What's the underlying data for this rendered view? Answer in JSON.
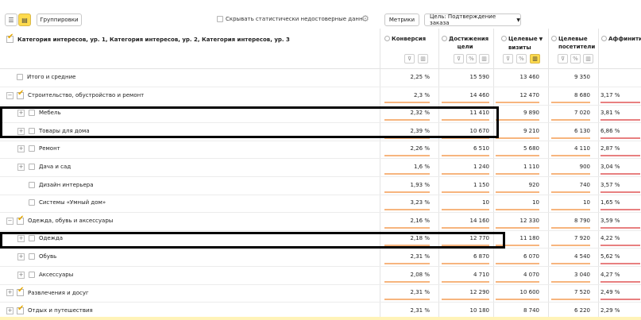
{
  "toolbar": {
    "groupings_label": "Группировки",
    "hide_stats_label": "Скрывать статистически недостоверные данн...",
    "metrics_label": "Метрики",
    "goal_label": "Цель: Подтверждение заказа",
    "icons": [
      "list-view-icon",
      "tree-view-icon",
      "gear-icon",
      "chevron-down-icon"
    ]
  },
  "header": {
    "dimension_title": "Категория интересов, ур. 1, Категория интересов, ур. 2, Категория интересов, ур. 3",
    "columns": [
      {
        "line1": "Конверсия",
        "line2": ""
      },
      {
        "line1": "Достижения",
        "line2": "цели"
      },
      {
        "line1": "Целевые",
        "line2": "визиты",
        "sort": "▼"
      },
      {
        "line1": "Целевые",
        "line2": "посетители"
      },
      {
        "line1": "Аффинити-",
        "line2": ""
      }
    ],
    "mini_icons": [
      "filter-icon",
      "chart-icon",
      "percent-icon"
    ]
  },
  "rows": [
    {
      "level": 0,
      "label": "Итого и средние",
      "checked": false,
      "expander": "",
      "conv": "2,25 %",
      "goals": "15 590",
      "visits": "13 460",
      "visitors": "9 350",
      "aff": ""
    },
    {
      "level": 0,
      "label": "Строительство, обустройство и ремонт",
      "checked": true,
      "expander": "−",
      "conv": "2,3 %",
      "goals": "14 460",
      "visits": "12 470",
      "visitors": "8 680",
      "aff": "3,17 %"
    },
    {
      "level": 1,
      "label": "Мебель",
      "checked": false,
      "expander": "+",
      "conv": "2,32 %",
      "goals": "11 410",
      "visits": "9 890",
      "visitors": "7 020",
      "aff": "3,81 %"
    },
    {
      "level": 1,
      "label": "Товары для дома",
      "checked": false,
      "expander": "+",
      "conv": "2,39 %",
      "goals": "10 670",
      "visits": "9 210",
      "visitors": "6 130",
      "aff": "6,86 %"
    },
    {
      "level": 1,
      "label": "Ремонт",
      "checked": false,
      "expander": "+",
      "conv": "2,26 %",
      "goals": "6 510",
      "visits": "5 680",
      "visitors": "4 110",
      "aff": "2,87 %"
    },
    {
      "level": 1,
      "label": "Дача и сад",
      "checked": false,
      "expander": "+",
      "conv": "1,6 %",
      "goals": "1 240",
      "visits": "1 110",
      "visitors": "900",
      "aff": "3,04 %"
    },
    {
      "level": 1,
      "label": "Дизайн интерьера",
      "checked": false,
      "expander": "",
      "conv": "1,93 %",
      "goals": "1 150",
      "visits": "920",
      "visitors": "740",
      "aff": "3,57 %"
    },
    {
      "level": 1,
      "label": "Системы «Умный дом»",
      "checked": false,
      "expander": "",
      "conv": "3,23 %",
      "goals": "10",
      "visits": "10",
      "visitors": "10",
      "aff": "1,65 %"
    },
    {
      "level": 0,
      "label": "Одежда, обувь и аксессуары",
      "checked": true,
      "expander": "−",
      "conv": "2,16 %",
      "goals": "14 160",
      "visits": "12 330",
      "visitors": "8 790",
      "aff": "3,59 %"
    },
    {
      "level": 1,
      "label": "Одежда",
      "checked": false,
      "expander": "+",
      "conv": "2,18 %",
      "goals": "12 770",
      "visits": "11 180",
      "visitors": "7 920",
      "aff": "4,22 %"
    },
    {
      "level": 1,
      "label": "Обувь",
      "checked": false,
      "expander": "+",
      "conv": "2,31 %",
      "goals": "6 870",
      "visits": "6 070",
      "visitors": "4 540",
      "aff": "5,62 %"
    },
    {
      "level": 1,
      "label": "Аксессуары",
      "checked": false,
      "expander": "+",
      "conv": "2,08 %",
      "goals": "4 710",
      "visits": "4 070",
      "visitors": "3 040",
      "aff": "4,27 %"
    },
    {
      "level": 0,
      "label": "Развлечения и досуг",
      "checked": true,
      "expander": "+",
      "conv": "2,31 %",
      "goals": "12 290",
      "visits": "10 600",
      "visitors": "7 520",
      "aff": "2,49 %"
    },
    {
      "level": 0,
      "label": "Отдых и путешествия",
      "checked": true,
      "expander": "+",
      "conv": "2,31 %",
      "goals": "10 180",
      "visits": "8 740",
      "visitors": "6 220",
      "aff": "2,29 %"
    }
  ],
  "colors": {
    "accent_yellow": "#ffdb4d",
    "check_orange": "#e6a800",
    "bar_orange": "#f7b57e",
    "bar_red": "#e88080"
  }
}
